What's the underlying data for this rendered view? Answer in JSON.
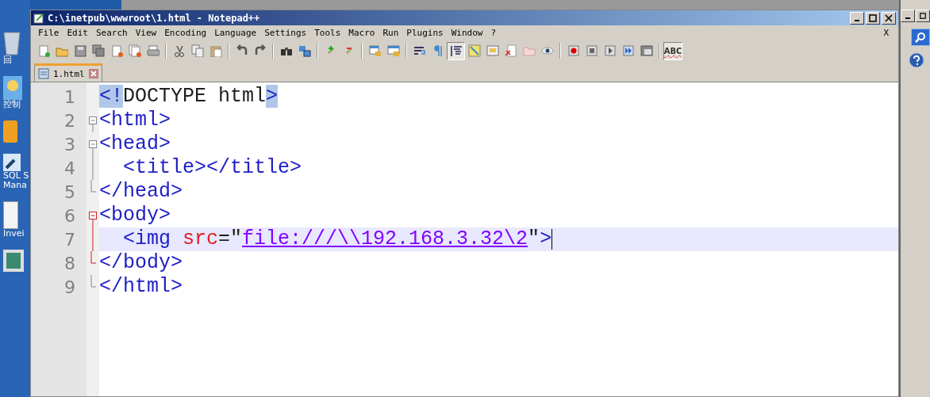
{
  "desktop": {
    "icons": [
      {
        "kind": "bin",
        "labels": [
          "回"
        ]
      },
      {
        "kind": "panel",
        "labels": [
          "控制"
        ]
      },
      {
        "kind": "database"
      },
      {
        "kind": "shortcut",
        "labels": [
          "SQL S",
          "Mana"
        ]
      },
      {
        "kind": "document",
        "labels": [
          "Invei"
        ]
      },
      {
        "kind": "frame"
      }
    ]
  },
  "window": {
    "title": "C:\\inetpub\\wwwroot\\1.html - Notepad++"
  },
  "menu": [
    "File",
    "Edit",
    "Search",
    "View",
    "Encoding",
    "Language",
    "Settings",
    "Tools",
    "Macro",
    "Run",
    "Plugins",
    "Window",
    "?"
  ],
  "menu_close": "X",
  "toolbar": [
    {
      "kind": "button",
      "pressed": false
    },
    {
      "kind": "button",
      "pressed": false
    },
    {
      "kind": "button",
      "pressed": false
    },
    {
      "kind": "button",
      "pressed": false
    },
    {
      "kind": "button",
      "pressed": false
    },
    {
      "kind": "button",
      "pressed": false
    },
    {
      "kind": "button",
      "pressed": false
    },
    {
      "kind": "separator"
    },
    {
      "kind": "button",
      "pressed": false
    },
    {
      "kind": "button",
      "pressed": false
    },
    {
      "kind": "button",
      "pressed": false
    },
    {
      "kind": "separator"
    },
    {
      "kind": "button",
      "pressed": false
    },
    {
      "kind": "button",
      "pressed": false
    },
    {
      "kind": "separator"
    },
    {
      "kind": "button",
      "pressed": false
    },
    {
      "kind": "button",
      "pressed": false
    },
    {
      "kind": "separator"
    },
    {
      "kind": "button",
      "pressed": false
    },
    {
      "kind": "button",
      "pressed": false
    },
    {
      "kind": "separator"
    },
    {
      "kind": "button",
      "pressed": false
    },
    {
      "kind": "button",
      "pressed": false
    },
    {
      "kind": "separator"
    },
    {
      "kind": "button",
      "pressed": false
    },
    {
      "kind": "button",
      "pressed": false
    },
    {
      "kind": "button",
      "pressed": true
    },
    {
      "kind": "button",
      "pressed": false
    },
    {
      "kind": "button",
      "pressed": false
    },
    {
      "kind": "button",
      "pressed": false
    },
    {
      "kind": "button",
      "pressed": false
    },
    {
      "kind": "button",
      "pressed": false
    },
    {
      "kind": "separator"
    },
    {
      "kind": "button",
      "pressed": false
    },
    {
      "kind": "button",
      "pressed": false
    },
    {
      "kind": "button",
      "pressed": false
    },
    {
      "kind": "button",
      "pressed": false
    },
    {
      "kind": "button",
      "pressed": false
    },
    {
      "kind": "separator"
    },
    {
      "kind": "text_button",
      "pressed": true,
      "label": "ABC"
    }
  ],
  "tabs": [
    {
      "label": "1.html",
      "selected": true
    }
  ],
  "editor": {
    "lines": [
      {
        "number": "1",
        "kind": "none",
        "current": false,
        "tokens": [
          {
            "text": "<!",
            "kind": "tag",
            "highlight": true
          },
          {
            "text": "DOCTYPE html",
            "kind": "text",
            "highlight": false
          },
          {
            "text": ">",
            "kind": "tag",
            "highlight": true
          }
        ]
      },
      {
        "number": "2",
        "kind": "open",
        "active_fold": false,
        "current": false,
        "tokens": [
          {
            "text": "<html>",
            "kind": "tag",
            "highlight": false
          }
        ]
      },
      {
        "number": "3",
        "kind": "open",
        "active_fold": false,
        "current": false,
        "tokens": [
          {
            "text": "<head>",
            "kind": "tag",
            "highlight": false
          }
        ]
      },
      {
        "number": "4",
        "kind": "line",
        "active_fold": false,
        "current": false,
        "tokens": [
          {
            "text": "  <title></title>",
            "kind": "tag",
            "highlight": false
          }
        ]
      },
      {
        "number": "5",
        "kind": "close",
        "active_fold": false,
        "current": false,
        "tokens": [
          {
            "text": "</head>",
            "kind": "tag",
            "highlight": false
          }
        ]
      },
      {
        "number": "6",
        "kind": "open",
        "active_fold": true,
        "current": false,
        "tokens": [
          {
            "text": "<body>",
            "kind": "tag",
            "highlight": false
          }
        ]
      },
      {
        "number": "7",
        "kind": "line",
        "active_fold": true,
        "current": true,
        "tokens": [
          {
            "text": "  <img",
            "kind": "tag",
            "highlight": false
          },
          {
            "text": " src",
            "kind": "attr",
            "highlight": false
          },
          {
            "text": "=\"",
            "kind": "text",
            "highlight": false
          },
          {
            "text": "file:///\\\\192.168.3.32\\2",
            "kind": "link",
            "highlight": false
          },
          {
            "text": "\"",
            "kind": "text",
            "highlight": false
          },
          {
            "text": ">",
            "kind": "tag",
            "highlight": false
          }
        ]
      },
      {
        "number": "8",
        "kind": "close",
        "active_fold": true,
        "current": false,
        "tokens": [
          {
            "text": "</body>",
            "kind": "tag",
            "highlight": false
          }
        ]
      },
      {
        "number": "9",
        "kind": "close",
        "active_fold": false,
        "current": false,
        "tokens": [
          {
            "text": "</html>",
            "kind": "tag",
            "highlight": false
          }
        ]
      }
    ]
  }
}
